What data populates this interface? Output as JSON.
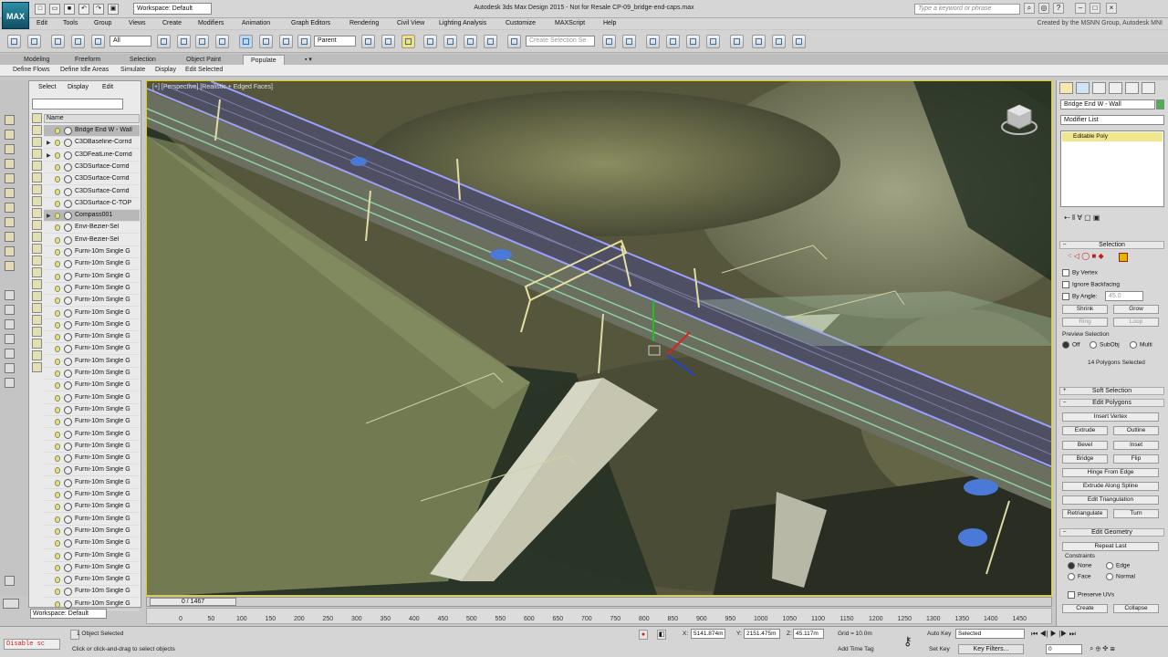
{
  "app": {
    "logo_text": "MAX",
    "window_title": "Autodesk 3ds Max Design 2015  -  Not for Resale   CP-09_bridge-end-caps.max",
    "workspace": "Workspace: Default",
    "search_placeholder": "Type a keyword or phrase",
    "credit": "Created by the MSNN Group, Autodesk MNI"
  },
  "menus": [
    "Edit",
    "Tools",
    "Group",
    "Views",
    "Create",
    "Modifiers",
    "Animation",
    "Graph Editors",
    "Rendering",
    "Civil View",
    "Lighting Analysis",
    "Customize",
    "MAXScript",
    "Help"
  ],
  "toolbar": {
    "filter": "All",
    "ref_coord": "Parent",
    "named_sel_placeholder": "Create Selection Se"
  },
  "ribbon": {
    "tabs": [
      "Modeling",
      "Freeform",
      "Selection",
      "Object Paint",
      "Populate"
    ],
    "active_tab": "Populate",
    "commands": [
      "Define Flows",
      "Define Idle Areas",
      "Simulate",
      "Display",
      "Edit Selected"
    ]
  },
  "scene_explorer": {
    "tabs": [
      "Select",
      "Display",
      "Edit"
    ],
    "column": "Name",
    "rows": [
      {
        "name": "Bridge End W - Wall",
        "sel": true,
        "exp": ""
      },
      {
        "name": "C3DBaseline-Corrid",
        "sel": false,
        "exp": "▶"
      },
      {
        "name": "C3DFeatLine-Corrid",
        "sel": false,
        "exp": "▶"
      },
      {
        "name": "C3DSurface-Corrid",
        "sel": false,
        "exp": ""
      },
      {
        "name": "C3DSurface-Corrid",
        "sel": false,
        "exp": ""
      },
      {
        "name": "C3DSurface-Corrid",
        "sel": false,
        "exp": ""
      },
      {
        "name": "C3DSurface-C-TOP",
        "sel": false,
        "exp": ""
      },
      {
        "name": "Compass001",
        "sel": true,
        "exp": "▶"
      },
      {
        "name": "Envi-Bezier-Sel",
        "sel": false,
        "exp": ""
      },
      {
        "name": "Envi-Bezier-Sel",
        "sel": false,
        "exp": ""
      },
      {
        "name": "Furni-10m Single G",
        "sel": false,
        "exp": ""
      },
      {
        "name": "Furni-10m Single G",
        "sel": false,
        "exp": ""
      },
      {
        "name": "Furni-10m Single G",
        "sel": false,
        "exp": ""
      },
      {
        "name": "Furni-10m Single G",
        "sel": false,
        "exp": ""
      },
      {
        "name": "Furni-10m Single G",
        "sel": false,
        "exp": ""
      },
      {
        "name": "Furni-10m Single G",
        "sel": false,
        "exp": ""
      },
      {
        "name": "Furni-10m Single G",
        "sel": false,
        "exp": ""
      },
      {
        "name": "Furni-10m Single G",
        "sel": false,
        "exp": ""
      },
      {
        "name": "Furni-10m Single G",
        "sel": false,
        "exp": ""
      },
      {
        "name": "Furni-10m Single G",
        "sel": false,
        "exp": ""
      },
      {
        "name": "Furni-10m Single G",
        "sel": false,
        "exp": ""
      },
      {
        "name": "Furni-10m Single G",
        "sel": false,
        "exp": ""
      },
      {
        "name": "Furni-10m Single G",
        "sel": false,
        "exp": ""
      },
      {
        "name": "Furni-10m Single G",
        "sel": false,
        "exp": ""
      },
      {
        "name": "Furni-10m Single G",
        "sel": false,
        "exp": ""
      },
      {
        "name": "Furni-10m Single G",
        "sel": false,
        "exp": ""
      },
      {
        "name": "Furni-10m Single G",
        "sel": false,
        "exp": ""
      },
      {
        "name": "Furni-10m Single G",
        "sel": false,
        "exp": ""
      },
      {
        "name": "Furni-10m Single G",
        "sel": false,
        "exp": ""
      },
      {
        "name": "Furni-10m Single G",
        "sel": false,
        "exp": ""
      },
      {
        "name": "Furni-10m Single G",
        "sel": false,
        "exp": ""
      },
      {
        "name": "Furni-10m Single G",
        "sel": false,
        "exp": ""
      },
      {
        "name": "Furni-10m Single G",
        "sel": false,
        "exp": ""
      },
      {
        "name": "Furni-10m Single G",
        "sel": false,
        "exp": ""
      },
      {
        "name": "Furni-10m Single G",
        "sel": false,
        "exp": ""
      },
      {
        "name": "Furni-10m Single G",
        "sel": false,
        "exp": ""
      },
      {
        "name": "Furni-10m Single G",
        "sel": false,
        "exp": ""
      },
      {
        "name": "Furni-10m Single G",
        "sel": false,
        "exp": ""
      },
      {
        "name": "Furni-10m Single G",
        "sel": false,
        "exp": ""
      },
      {
        "name": "Furni-10m Single G",
        "sel": false,
        "exp": ""
      }
    ],
    "workspace_combo": "Workspace: Default"
  },
  "viewport": {
    "label": "[+] [Perspective] [Realistic + Edged Faces]"
  },
  "timeline": {
    "position": "0 / 1467",
    "ticks": [
      "0",
      "50",
      "100",
      "150",
      "200",
      "250",
      "300",
      "350",
      "400",
      "450",
      "500",
      "550",
      "600",
      "650",
      "700",
      "750",
      "800",
      "850",
      "900",
      "950",
      "1000",
      "1050",
      "1100",
      "1150",
      "1200",
      "1250",
      "1300",
      "1350",
      "1400",
      "1450"
    ]
  },
  "status": {
    "maxscript": "Disable sc",
    "selection": "1 Object Selected",
    "prompt": "Click or click-and-drag to select objects",
    "x_value": "5141.874m",
    "y_value": "2151.475m",
    "z_value": "45.117m",
    "grid": "Grid = 10.0m",
    "auto_key": "Auto Key",
    "set_key": "Set Key",
    "selected_combo": "Selected",
    "key_filters": "Key Filters...",
    "add_time_tag": "Add Time Tag",
    "frame": "0"
  },
  "command_panel": {
    "object_name": "Bridge End W - Wall",
    "modifier_list": "Modifier List",
    "stack_item": "Editable Poly",
    "selection_title": "Selection",
    "by_vertex": "By Vertex",
    "ignore_backfacing": "Ignore Backfacing",
    "by_angle": "By Angle:",
    "angle_value": "45.0",
    "shrink": "Shrink",
    "grow": "Grow",
    "ring": "Ring",
    "loop": "Loop",
    "preview_selection": "Preview Selection",
    "preview_off": "Off",
    "preview_subobj": "SubObj",
    "preview_multi": "Multi",
    "selected_count": "14 Polygons Selected",
    "soft_selection": "Soft Selection",
    "edit_polygons": "Edit Polygons",
    "insert_vertex": "Insert Vertex",
    "extrude": "Extrude",
    "outline": "Outline",
    "bevel": "Bevel",
    "inset": "Inset",
    "bridge": "Bridge",
    "flip": "Flip",
    "hinge_from_edge": "Hinge From Edge",
    "extrude_along_spline": "Extrude Along Spline",
    "edit_triangulation": "Edit Triangulation",
    "retriangulate": "Retriangulate",
    "turn": "Turn",
    "edit_geometry": "Edit Geometry",
    "repeat_last": "Repeat Last",
    "constraints": "Constraints",
    "c_none": "None",
    "c_edge": "Edge",
    "c_face": "Face",
    "c_normal": "Normal",
    "preserve_uvs": "Preserve UVs",
    "create": "Create",
    "collapse": "Collapse"
  },
  "colors": {
    "accent_yellow": "#e3d200",
    "selection_red": "#e02020",
    "terrain": "#55563c",
    "road": "#4f4f63"
  }
}
